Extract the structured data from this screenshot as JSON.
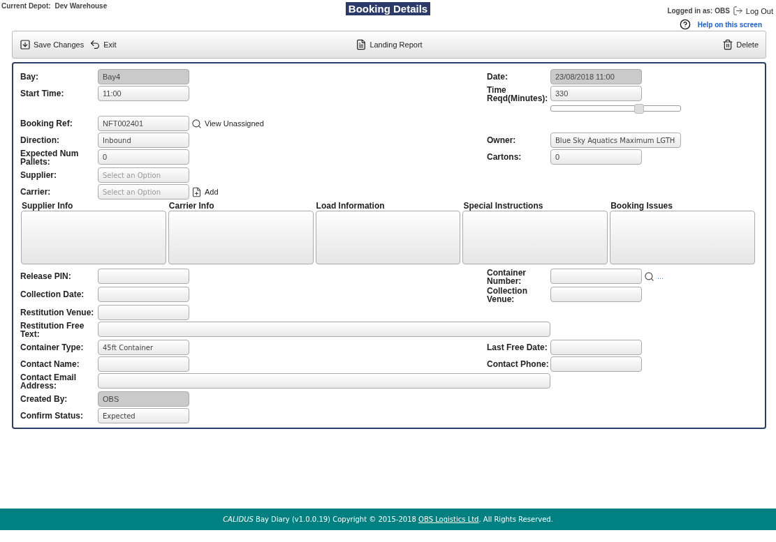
{
  "header": {
    "depot_label": "Current Depot:",
    "depot": "Dev Warehouse",
    "title": "Booking Details",
    "logged_in": "Logged in as: OBS",
    "logout": "Log Out",
    "help": "Help on this screen"
  },
  "toolbar": {
    "left": [
      {
        "kind": "save",
        "label": "Save Changes"
      },
      {
        "kind": "exit",
        "label": "Exit"
      }
    ],
    "center": [
      {
        "kind": "report",
        "label": "Landing Report"
      }
    ],
    "right": [
      {
        "kind": "delete",
        "label": "Delete"
      }
    ]
  },
  "rows_top": [
    {
      "left": {
        "label": "Bay:",
        "kind": "text",
        "value": "Bay4",
        "disabled": true
      },
      "right": {
        "label": "Date:",
        "kind": "text",
        "value": "23/08/2018 11:00",
        "disabled": true
      }
    },
    {
      "left": {
        "label": "Start Time:",
        "kind": "text",
        "value": "11:00",
        "disabled": false
      },
      "right": {
        "label": "Time Reqd(Minutes):",
        "kind": "text",
        "value": "330",
        "disabled": false,
        "slider": {
          "level": 0.68
        }
      }
    },
    {
      "left": {
        "label": "Booking Ref:",
        "kind": "text",
        "value": "NFT002401",
        "disabled": false,
        "action": {
          "kind": "search",
          "label": "View Unassigned"
        }
      }
    },
    {
      "left": {
        "label": "Direction:",
        "kind": "select",
        "value": "Inbound",
        "disabled": false
      },
      "right": {
        "label": "Owner:",
        "kind": "select",
        "value": "Blue Sky Aquatics Maximum LGTH",
        "disabled": false
      }
    },
    {
      "left": {
        "label": "Expected Num Pallets:",
        "kind": "text",
        "value": "0",
        "disabled": false
      },
      "right": {
        "label": "Cartons:",
        "kind": "text",
        "value": "0",
        "disabled": false
      }
    },
    {
      "left": {
        "label": "Supplier:",
        "kind": "select",
        "placeholder": "Select an Option",
        "disabled": false
      }
    },
    {
      "left": {
        "label": "Carrier:",
        "kind": "select",
        "placeholder": "Select an Option",
        "disabled": false,
        "action": {
          "kind": "add",
          "label": "Add"
        }
      }
    }
  ],
  "info_boxes": [
    {
      "label": "Supplier Info"
    },
    {
      "label": "Carrier Info"
    },
    {
      "label": "Load Information"
    },
    {
      "label": "Special Instructions"
    },
    {
      "label": "Booking Issues"
    }
  ],
  "rows_bottom": [
    {
      "left": {
        "label": "Release PIN:",
        "kind": "text",
        "disabled": false
      },
      "right": {
        "label": "Container Number:",
        "kind": "text",
        "disabled": false,
        "action": {
          "kind": "search",
          "label": "..."
        }
      }
    },
    {
      "left": {
        "label": "Collection Date:",
        "kind": "text",
        "disabled": false
      },
      "right": {
        "label": "Collection Venue:",
        "kind": "text",
        "disabled": false
      }
    },
    {
      "left": {
        "label": "Restitution Venue:",
        "kind": "text",
        "disabled": false
      }
    },
    {
      "left": {
        "label": "Restitution Free Text:",
        "kind": "wide",
        "disabled": false
      }
    },
    {
      "left": {
        "label": "Container Type:",
        "kind": "select",
        "value": "45ft Container",
        "disabled": false
      },
      "right": {
        "label": "Last Free Date:",
        "kind": "text",
        "disabled": false
      }
    },
    {
      "left": {
        "label": "Contact Name:",
        "kind": "text",
        "disabled": false
      },
      "right": {
        "label": "Contact Phone:",
        "kind": "text",
        "disabled": false
      }
    },
    {
      "left": {
        "label": "Contact Email Address:",
        "kind": "wide",
        "disabled": false
      }
    },
    {
      "left": {
        "label": "Created By:",
        "kind": "text",
        "value": "OBS",
        "disabled": true
      }
    },
    {
      "left": {
        "label": "Confirm Status:",
        "kind": "select",
        "value": "Expected",
        "disabled": false
      }
    }
  ],
  "footer": {
    "text": "*CALIDUS* Bay Diary (v1.0.0.19) Copyright © 2015-2018",
    "link": "OBS Logistics Ltd",
    "suffix": ". All Rights Reserved."
  }
}
